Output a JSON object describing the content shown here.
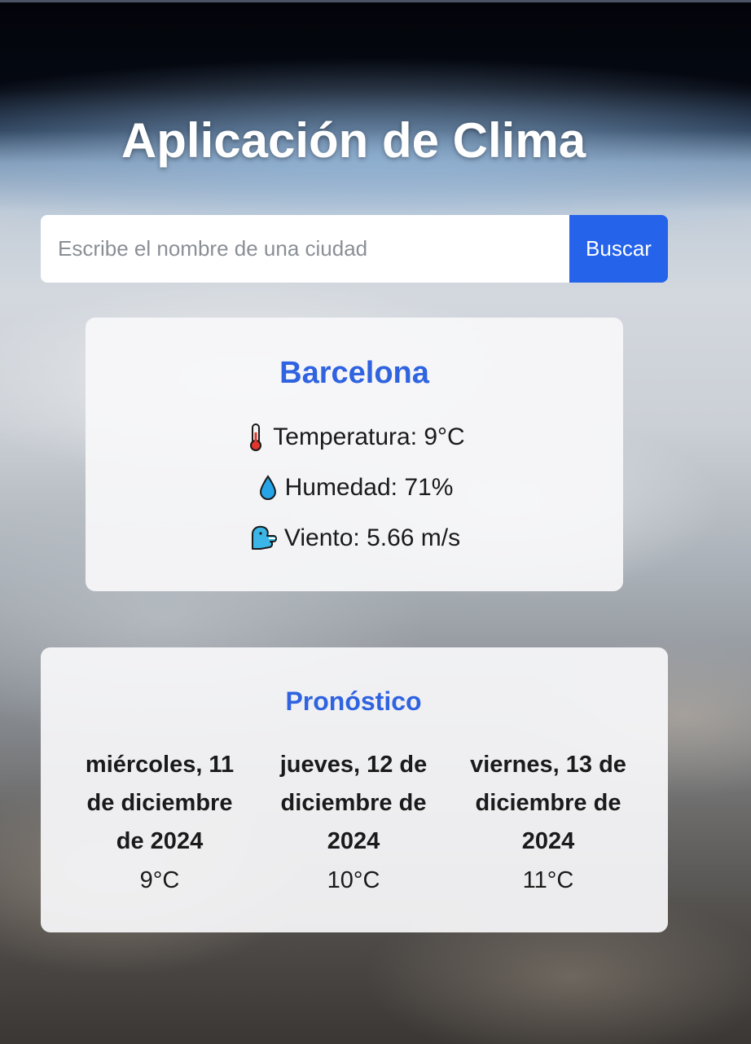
{
  "app": {
    "title": "Aplicación de Clima"
  },
  "search": {
    "placeholder": "Escribe el nombre de una ciudad",
    "value": "",
    "button_label": "Buscar"
  },
  "current": {
    "city": "Barcelona",
    "temperature": "Temperatura: 9°C",
    "humidity": "Humedad: 71%",
    "wind": "Viento: 5.66 m/s",
    "icons": [
      "thermometer-icon",
      "droplet-icon",
      "wind-face-icon"
    ]
  },
  "forecast": {
    "title": "Pronóstico",
    "days": [
      {
        "date": "miércoles, 11 de diciembre de 2024",
        "temp": "9°C"
      },
      {
        "date": "jueves, 12 de diciembre de 2024",
        "temp": "10°C"
      },
      {
        "date": "viernes, 13 de diciembre de 2024",
        "temp": "11°C"
      }
    ]
  },
  "colors": {
    "accent": "#2563eb",
    "heading_blue": "#2f63e0",
    "card_bg": "#f7f8fa"
  }
}
